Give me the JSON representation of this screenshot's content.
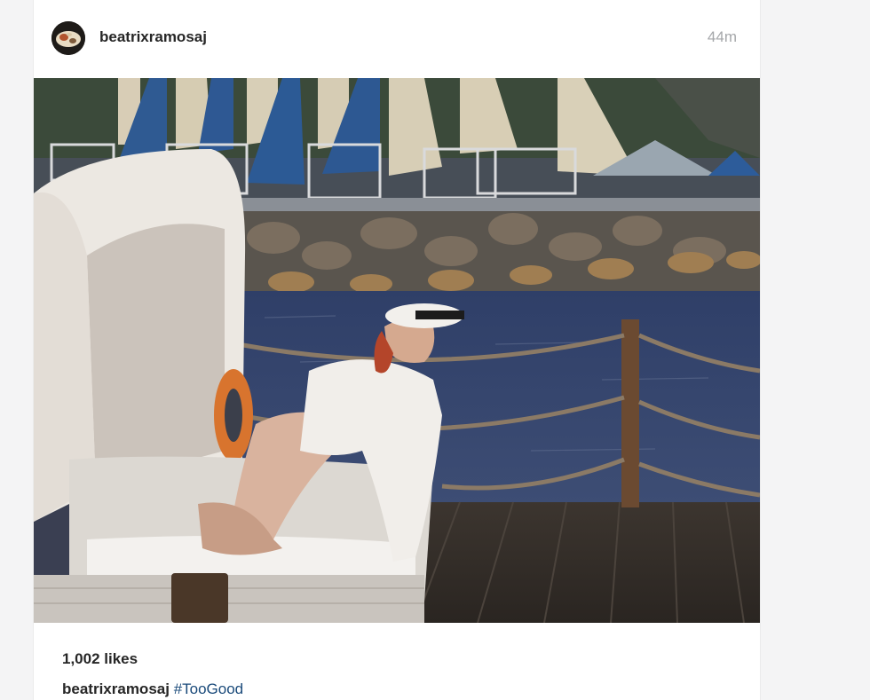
{
  "post": {
    "username": "beatrixramosaj",
    "time_ago": "44m",
    "likes": "1,002 likes",
    "caption": {
      "username": "beatrixramosaj",
      "hashtag": "#TooGood"
    }
  },
  "icons": {
    "avatar": "profile-avatar"
  },
  "colors": {
    "text": "#262626",
    "timestamp": "#a5a7aa",
    "hashtag": "#1a4a7a",
    "page_background": "#f4f4f5"
  }
}
